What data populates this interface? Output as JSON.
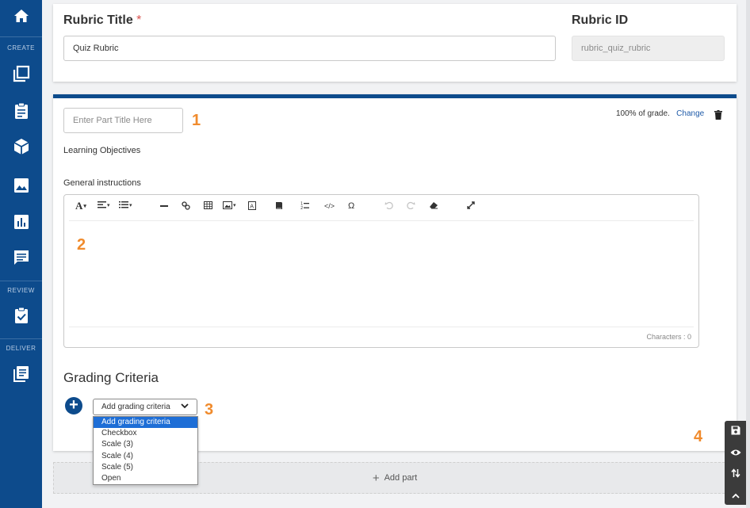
{
  "sidebar": {
    "sections": {
      "create": "CREATE",
      "review": "REVIEW",
      "deliver": "DELIVER"
    },
    "items": [
      {
        "icon": "home-icon"
      },
      {
        "icon": "copy-icon"
      },
      {
        "icon": "clipboard-icon"
      },
      {
        "icon": "cube-icon"
      },
      {
        "icon": "image-icon"
      },
      {
        "icon": "bar-chart-icon"
      },
      {
        "icon": "comment-icon"
      },
      {
        "icon": "clipboard-check-icon"
      },
      {
        "icon": "book-icon"
      }
    ],
    "color": "#0d4b8c"
  },
  "rubric": {
    "title_label": "Rubric Title",
    "required_mark": "*",
    "title_value": "Quiz Rubric",
    "id_label": "Rubric ID",
    "id_value": "rubric_quiz_rubric"
  },
  "part": {
    "title_placeholder": "Enter Part Title Here",
    "grade_text": "100% of grade.",
    "change_label": "Change",
    "learning_objectives_label": "Learning Objectives",
    "general_instructions_label": "General instructions",
    "editor": {
      "characters_text": "Characters : 0",
      "toolbar": [
        "font-icon",
        "align-icon",
        "list-icon",
        "horizontal-rule-icon",
        "link-icon",
        "table-icon",
        "image-icon",
        "template-icon",
        "book-icon",
        "numbered-list-icon",
        "code-icon",
        "omega-icon",
        "undo-icon",
        "redo-icon",
        "eraser-icon",
        "expand-icon"
      ]
    }
  },
  "grading": {
    "title": "Grading Criteria",
    "select_value": "Add grading criteria",
    "options": [
      "Add grading criteria",
      "Checkbox",
      "Scale (3)",
      "Scale (4)",
      "Scale (5)",
      "Open"
    ]
  },
  "add_part_label": "Add part",
  "markers": {
    "m1": "1",
    "m2": "2",
    "m3": "3",
    "m4": "4"
  },
  "accent_color": "#f08b2d"
}
